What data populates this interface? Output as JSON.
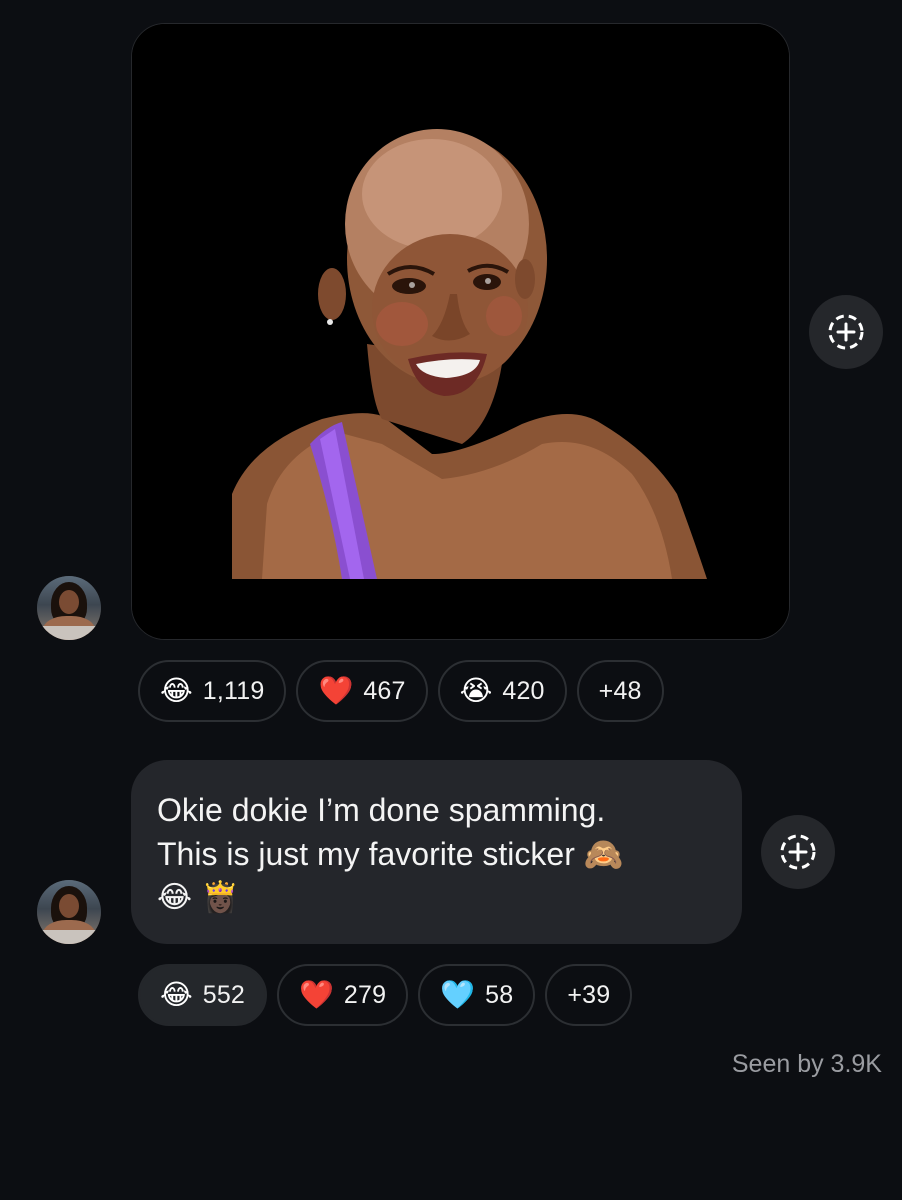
{
  "messages": [
    {
      "type": "sticker",
      "sticker_description_icon": "sticker-image-icon",
      "reactions": [
        {
          "emoji": "😂",
          "icon": "tears-of-joy-emoji-icon",
          "count": "1,119",
          "active": false
        },
        {
          "emoji": "❤️",
          "icon": "red-heart-emoji-icon",
          "count": "467",
          "active": false
        },
        {
          "emoji": "😭",
          "icon": "loudly-crying-emoji-icon",
          "count": "420",
          "active": false
        },
        {
          "emoji": "",
          "icon": "",
          "count": "+48",
          "active": false
        }
      ]
    },
    {
      "type": "text",
      "line1": "Okie dokie I’m done spamming.",
      "line2": "This is just my favorite sticker 🙈",
      "line3": "😂 👸🏿",
      "reactions": [
        {
          "emoji": "😂",
          "icon": "tears-of-joy-emoji-icon",
          "count": "552",
          "active": true
        },
        {
          "emoji": "❤️",
          "icon": "red-heart-emoji-icon",
          "count": "279",
          "active": false
        },
        {
          "emoji": "🩵",
          "icon": "light-blue-heart-emoji-icon",
          "count": "58",
          "active": false
        },
        {
          "emoji": "",
          "icon": "",
          "count": "+39",
          "active": false
        }
      ]
    }
  ],
  "seen_by": "Seen by 3.9K",
  "colors": {
    "background": "#0c0e12",
    "bubble": "#24262b",
    "chip_border": "#2c2f33",
    "muted_text": "#9a9ca1"
  }
}
